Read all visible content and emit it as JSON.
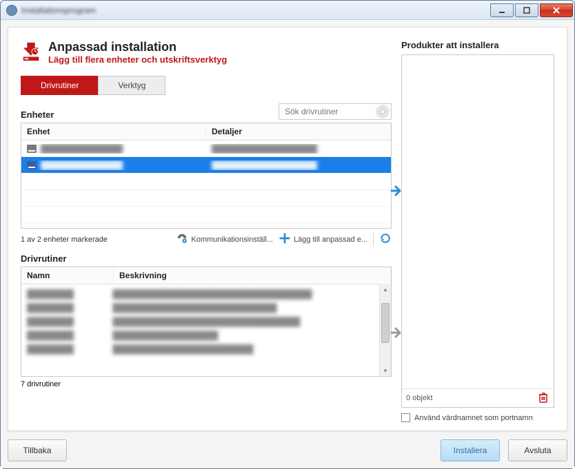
{
  "window": {
    "title": "Installationsprogram"
  },
  "header": {
    "title": "Anpassad installation",
    "subtitle": "Lägg till flera enheter och utskriftsverktyg"
  },
  "tabs": {
    "drivers": "Drivrutiner",
    "tools": "Verktyg"
  },
  "search": {
    "placeholder": "Sök drivrutiner"
  },
  "devices": {
    "section_label": "Enheter",
    "col_enhet": "Enhet",
    "col_detaljer": "Detaljer",
    "rows": [
      {
        "name": "██████████████",
        "details": "██████████████████"
      },
      {
        "name": "██████████████",
        "details": "██████████████████"
      }
    ],
    "status": "1 av 2 enheter markerade"
  },
  "device_toolbar": {
    "comm": "Kommunikationsinställ...",
    "add_custom": "Lägg till anpassad e..."
  },
  "drivers_section": {
    "label": "Drivrutiner",
    "col_name": "Namn",
    "col_desc": "Beskrivning",
    "rows": [
      {
        "name": "████████",
        "desc": "██████████████████████████████████"
      },
      {
        "name": "████████",
        "desc": "████████████████████████████"
      },
      {
        "name": "████████",
        "desc": "████████████████████████████████"
      },
      {
        "name": "████████",
        "desc": "██████████████████"
      },
      {
        "name": "████████",
        "desc": "████████████████████████"
      }
    ],
    "status": "7 drivrutiner"
  },
  "products": {
    "title": "Produkter att installera",
    "count_label": "0 objekt"
  },
  "hostname_checkbox": "Använd värdnamnet som portnamn",
  "buttons": {
    "back": "Tillbaka",
    "install": "Installera",
    "exit": "Avsluta"
  }
}
